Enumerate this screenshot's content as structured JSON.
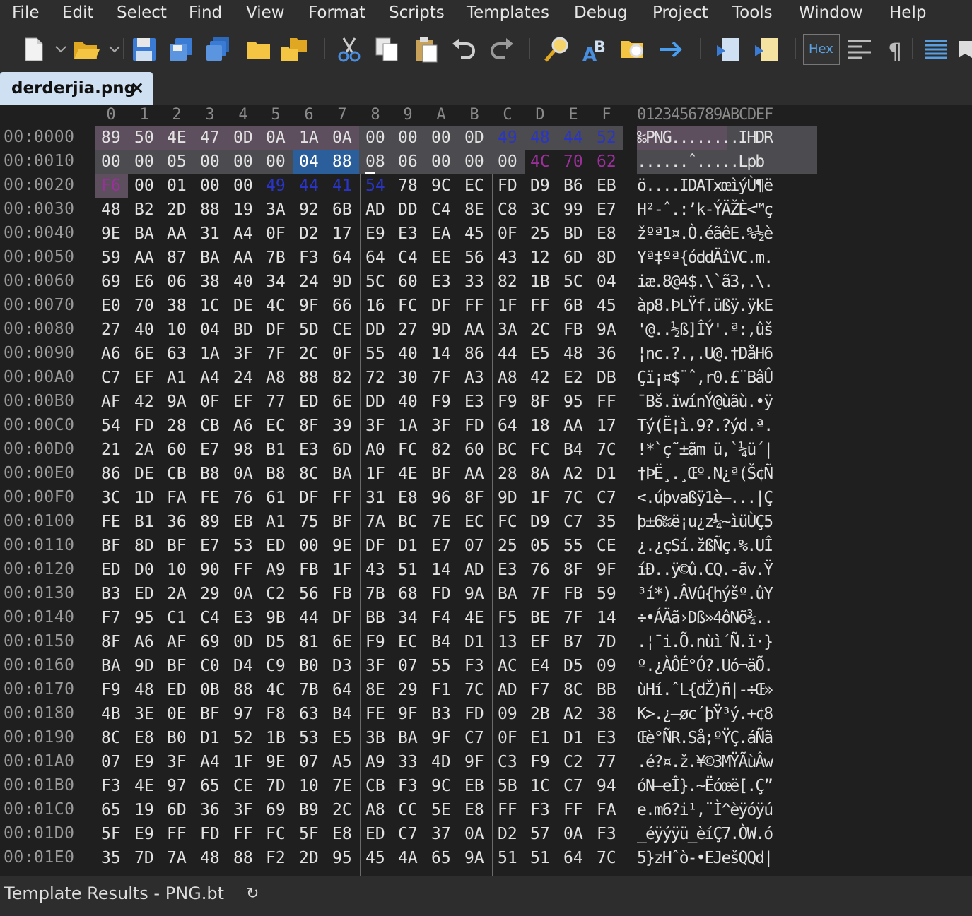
{
  "menu": [
    "File",
    "Edit",
    "Select",
    "Find",
    "View",
    "Format",
    "Scripts",
    "Templates",
    "Debug",
    "Project",
    "Tools",
    "Window",
    "Help"
  ],
  "toolbar": {
    "hex_label": "Hex",
    "icons": [
      "new-file-icon",
      "open-folder-icon",
      "save-icon",
      "save-as-icon",
      "save-all-icon",
      "open-project-icon",
      "open-templates-icon",
      "cut-icon",
      "copy-icon",
      "paste-icon",
      "undo-icon",
      "redo-icon",
      "find-icon",
      "replace-icon",
      "find-in-files-icon",
      "goto-icon",
      "run-script-icon",
      "run-template-icon",
      "hex-mode-icon",
      "format-icon",
      "pilcrow-icon",
      "columns-icon",
      "bookmark-icon"
    ]
  },
  "tab": {
    "title": "derderjia.png",
    "close": "×"
  },
  "columns": [
    "0",
    "1",
    "2",
    "3",
    "4",
    "5",
    "6",
    "7",
    "8",
    "9",
    "A",
    "B",
    "C",
    "D",
    "E",
    "F"
  ],
  "ascii_header": "0123456789ABCDEF",
  "rows": [
    {
      "addr": "00:0000",
      "bytes": [
        "89",
        "50",
        "4E",
        "47",
        "0D",
        "0A",
        "1A",
        "0A",
        "00",
        "00",
        "00",
        "0D",
        "49",
        "48",
        "44",
        "52"
      ],
      "ascii": "‰PNG........IHDR"
    },
    {
      "addr": "00:0010",
      "bytes": [
        "00",
        "00",
        "05",
        "00",
        "00",
        "00",
        "04",
        "88",
        "08",
        "06",
        "00",
        "00",
        "00",
        "4C",
        "70",
        "62"
      ],
      "ascii": "......ˆ.....Lpb"
    },
    {
      "addr": "00:0020",
      "bytes": [
        "F6",
        "00",
        "01",
        "00",
        "00",
        "49",
        "44",
        "41",
        "54",
        "78",
        "9C",
        "EC",
        "FD",
        "D9",
        "B6",
        "EB"
      ],
      "ascii": "ö....IDATxœìýÙ¶ë"
    },
    {
      "addr": "00:0030",
      "bytes": [
        "48",
        "B2",
        "2D",
        "88",
        "19",
        "3A",
        "92",
        "6B",
        "AD",
        "DD",
        "C4",
        "8E",
        "C8",
        "3C",
        "99",
        "E7"
      ],
      "ascii": "H²-ˆ.:’k-ÝÄŽÈ<™ç"
    },
    {
      "addr": "00:0040",
      "bytes": [
        "9E",
        "BA",
        "AA",
        "31",
        "A4",
        "0F",
        "D2",
        "17",
        "E9",
        "E3",
        "EA",
        "45",
        "0F",
        "25",
        "BD",
        "E8"
      ],
      "ascii": "žºª1¤.Ò.éãêE.%½è"
    },
    {
      "addr": "00:0050",
      "bytes": [
        "59",
        "AA",
        "87",
        "BA",
        "AA",
        "7B",
        "F3",
        "64",
        "64",
        "C4",
        "EE",
        "56",
        "43",
        "12",
        "6D",
        "8D"
      ],
      "ascii": "Yª‡ºª{óddÄîVC.m."
    },
    {
      "addr": "00:0060",
      "bytes": [
        "69",
        "E6",
        "06",
        "38",
        "40",
        "34",
        "24",
        "9D",
        "5C",
        "60",
        "E3",
        "33",
        "82",
        "1B",
        "5C",
        "04"
      ],
      "ascii": "iæ.8@4$.\\`ã3,.\\."
    },
    {
      "addr": "00:0070",
      "bytes": [
        "E0",
        "70",
        "38",
        "1C",
        "DE",
        "4C",
        "9F",
        "66",
        "16",
        "FC",
        "DF",
        "FF",
        "1F",
        "FF",
        "6B",
        "45"
      ],
      "ascii": "àp8.ÞLŸf.üßÿ.ÿkE"
    },
    {
      "addr": "00:0080",
      "bytes": [
        "27",
        "40",
        "10",
        "04",
        "BD",
        "DF",
        "5D",
        "CE",
        "DD",
        "27",
        "9D",
        "AA",
        "3A",
        "2C",
        "FB",
        "9A"
      ],
      "ascii": "'@..½ß]ÎÝ'.ª:,ûš"
    },
    {
      "addr": "00:0090",
      "bytes": [
        "A6",
        "6E",
        "63",
        "1A",
        "3F",
        "7F",
        "2C",
        "0F",
        "55",
        "40",
        "14",
        "86",
        "44",
        "E5",
        "48",
        "36"
      ],
      "ascii": "¦nc.?.,.U@.†DåH6"
    },
    {
      "addr": "00:00A0",
      "bytes": [
        "C7",
        "EF",
        "A1",
        "A4",
        "24",
        "A8",
        "88",
        "82",
        "72",
        "30",
        "7F",
        "A3",
        "A8",
        "42",
        "E2",
        "DB"
      ],
      "ascii": "Çï¡¤$¨ˆ‚r0.£¨BâÛ"
    },
    {
      "addr": "00:00B0",
      "bytes": [
        "AF",
        "42",
        "9A",
        "0F",
        "EF",
        "77",
        "ED",
        "6E",
        "DD",
        "40",
        "F9",
        "E3",
        "F9",
        "8F",
        "95",
        "FF"
      ],
      "ascii": "¯Bš.ïwínÝ@ùãù.•ÿ"
    },
    {
      "addr": "00:00C0",
      "bytes": [
        "54",
        "FD",
        "28",
        "CB",
        "A6",
        "EC",
        "8F",
        "39",
        "3F",
        "1A",
        "3F",
        "FD",
        "64",
        "18",
        "AA",
        "17"
      ],
      "ascii": "Tý(Ë¦ì.9?.?ýd.ª."
    },
    {
      "addr": "00:00D0",
      "bytes": [
        "21",
        "2A",
        "60",
        "E7",
        "98",
        "B1",
        "E3",
        "6D",
        "A0",
        "FC",
        "82",
        "60",
        "BC",
        "FC",
        "B4",
        "7C"
      ],
      "ascii": "!*`ç˜±ãm ü‚`¼ü´|"
    },
    {
      "addr": "00:00E0",
      "bytes": [
        "86",
        "DE",
        "CB",
        "B8",
        "0A",
        "B8",
        "8C",
        "BA",
        "1F",
        "4E",
        "BF",
        "AA",
        "28",
        "8A",
        "A2",
        "D1"
      ],
      "ascii": "†ÞË¸.¸Œº.N¿ª(Š¢Ñ"
    },
    {
      "addr": "00:00F0",
      "bytes": [
        "3C",
        "1D",
        "FA",
        "FE",
        "76",
        "61",
        "DF",
        "FF",
        "31",
        "E8",
        "96",
        "8F",
        "9D",
        "1F",
        "7C",
        "C7"
      ],
      "ascii": "<.úþvaßÿ1è–...|Ç"
    },
    {
      "addr": "00:0100",
      "bytes": [
        "FE",
        "B1",
        "36",
        "89",
        "EB",
        "A1",
        "75",
        "BF",
        "7A",
        "BC",
        "7E",
        "EC",
        "FC",
        "D9",
        "C7",
        "35"
      ],
      "ascii": "þ±6‰ë¡u¿z¼~ìüÙÇ5"
    },
    {
      "addr": "00:0110",
      "bytes": [
        "BF",
        "8D",
        "BF",
        "E7",
        "53",
        "ED",
        "00",
        "9E",
        "DF",
        "D1",
        "E7",
        "07",
        "25",
        "05",
        "55",
        "CE"
      ],
      "ascii": "¿.¿çSí.žßÑç.%.UÎ"
    },
    {
      "addr": "00:0120",
      "bytes": [
        "ED",
        "D0",
        "10",
        "90",
        "FF",
        "A9",
        "FB",
        "1F",
        "43",
        "51",
        "14",
        "AD",
        "E3",
        "76",
        "8F",
        "9F"
      ],
      "ascii": "íÐ..ÿ©û.CQ.-ãv.Ÿ"
    },
    {
      "addr": "00:0130",
      "bytes": [
        "B3",
        "ED",
        "2A",
        "29",
        "0A",
        "C2",
        "56",
        "FB",
        "7B",
        "68",
        "FD",
        "9A",
        "BA",
        "7F",
        "FB",
        "59"
      ],
      "ascii": "³í*).ÂVû{hýšº.ûY"
    },
    {
      "addr": "00:0140",
      "bytes": [
        "F7",
        "95",
        "C1",
        "C4",
        "E3",
        "9B",
        "44",
        "DF",
        "BB",
        "34",
        "F4",
        "4E",
        "F5",
        "BE",
        "7F",
        "14"
      ],
      "ascii": "÷•ÁÄã›Dß»4ôNõ¾.."
    },
    {
      "addr": "00:0150",
      "bytes": [
        "8F",
        "A6",
        "AF",
        "69",
        "0D",
        "D5",
        "81",
        "6E",
        "F9",
        "EC",
        "B4",
        "D1",
        "13",
        "EF",
        "B7",
        "7D"
      ],
      "ascii": ".¦¯i.Õ.nùì´Ñ.ï·}"
    },
    {
      "addr": "00:0160",
      "bytes": [
        "BA",
        "9D",
        "BF",
        "C0",
        "D4",
        "C9",
        "B0",
        "D3",
        "3F",
        "07",
        "55",
        "F3",
        "AC",
        "E4",
        "D5",
        "09"
      ],
      "ascii": "º.¿ÀÔÉ°Ó?.Uó¬äÕ."
    },
    {
      "addr": "00:0170",
      "bytes": [
        "F9",
        "48",
        "ED",
        "0B",
        "88",
        "4C",
        "7B",
        "64",
        "8E",
        "29",
        "F1",
        "7C",
        "AD",
        "F7",
        "8C",
        "BB"
      ],
      "ascii": "ùHí.ˆL{dŽ)ñ|-÷Œ»"
    },
    {
      "addr": "00:0180",
      "bytes": [
        "4B",
        "3E",
        "0E",
        "BF",
        "97",
        "F8",
        "63",
        "B4",
        "FE",
        "9F",
        "B3",
        "FD",
        "09",
        "2B",
        "A2",
        "38"
      ],
      "ascii": "K>.¿—øc´þŸ³ý.+¢8"
    },
    {
      "addr": "00:0190",
      "bytes": [
        "8C",
        "E8",
        "B0",
        "D1",
        "52",
        "1B",
        "53",
        "E5",
        "3B",
        "BA",
        "9F",
        "C7",
        "0F",
        "E1",
        "D1",
        "E3"
      ],
      "ascii": "Œè°ÑR.Så;ºŸÇ.áÑã"
    },
    {
      "addr": "00:01A0",
      "bytes": [
        "07",
        "E9",
        "3F",
        "A4",
        "1F",
        "9E",
        "07",
        "A5",
        "A9",
        "33",
        "4D",
        "9F",
        "C3",
        "F9",
        "C2",
        "77"
      ],
      "ascii": ".é?¤.ž.¥©3MŸÃùÂw"
    },
    {
      "addr": "00:01B0",
      "bytes": [
        "F3",
        "4E",
        "97",
        "65",
        "CE",
        "7D",
        "10",
        "7E",
        "CB",
        "F3",
        "9C",
        "EB",
        "5B",
        "1C",
        "C7",
        "94"
      ],
      "ascii": "óN—eÎ}.~Ëóœë[.Ç”"
    },
    {
      "addr": "00:01C0",
      "bytes": [
        "65",
        "19",
        "6D",
        "36",
        "3F",
        "69",
        "B9",
        "2C",
        "A8",
        "CC",
        "5E",
        "E8",
        "FF",
        "F3",
        "FF",
        "FA"
      ],
      "ascii": "e.m6?i¹,¨Ì^èÿóÿú"
    },
    {
      "addr": "00:01D0",
      "bytes": [
        "5F",
        "E9",
        "FF",
        "FD",
        "FF",
        "FC",
        "5F",
        "E8",
        "ED",
        "C7",
        "37",
        "0A",
        "D2",
        "57",
        "0A",
        "F3"
      ],
      "ascii": "_éÿýÿü_èíÇ7.ÒW.ó"
    },
    {
      "addr": "00:01E0",
      "bytes": [
        "35",
        "7D",
        "7A",
        "48",
        "88",
        "F2",
        "2D",
        "95",
        "45",
        "4A",
        "65",
        "9A",
        "51",
        "51",
        "64",
        "7C"
      ],
      "ascii": "5}zHˆò-•EJešQQd|"
    }
  ],
  "status": {
    "text": "Template Results - PNG.bt"
  },
  "colors": {
    "selection": "#4b4b50",
    "signature": "#5d4f5d",
    "highlight": "#2b5f9c",
    "chunk_type": "#2a35c7",
    "crc": "#9b2f9b"
  }
}
